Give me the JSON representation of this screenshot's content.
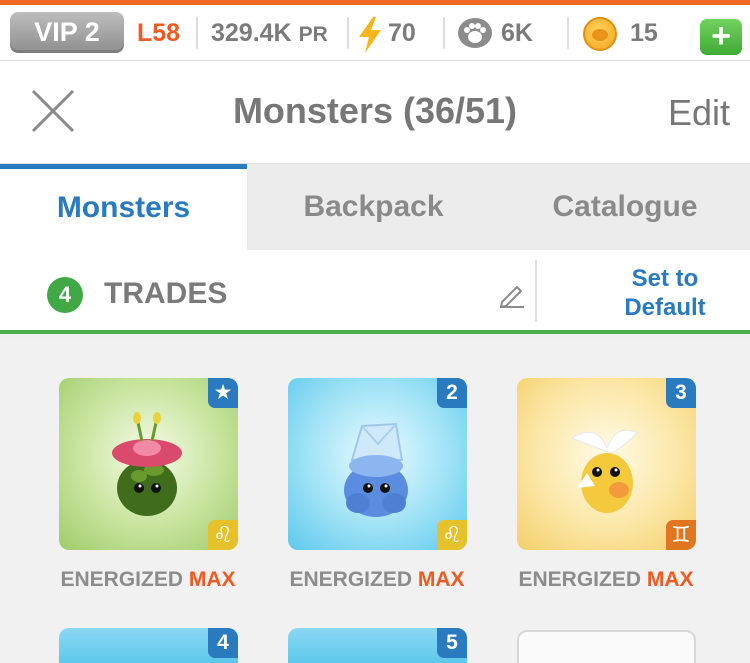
{
  "status_bar": {
    "vip": "VIP 2",
    "level": "L58",
    "power": "329.4K",
    "power_unit": "PR",
    "energy": "70",
    "paws": "6K",
    "coins": "15",
    "add_symbol": "+"
  },
  "header": {
    "title": "Monsters (36/51)",
    "edit_label": "Edit"
  },
  "tabs": [
    {
      "label": "Monsters",
      "active": true
    },
    {
      "label": "Backpack",
      "active": false
    },
    {
      "label": "Catalogue",
      "active": false
    }
  ],
  "trades": {
    "count": "4",
    "label": "TRADES",
    "set_default_line1": "Set to",
    "set_default_line2": "Default"
  },
  "cards": [
    {
      "slot": "★",
      "sign_icon": "leo-icon",
      "sign_glyph": "♌",
      "theme": "green",
      "label_energized": "ENERGIZED",
      "label_max": "MAX"
    },
    {
      "slot": "2",
      "sign_icon": "leo-icon",
      "sign_glyph": "♌",
      "theme": "blue",
      "label_energized": "ENERGIZED",
      "label_max": "MAX"
    },
    {
      "slot": "3",
      "sign_icon": "gemini-icon",
      "sign_glyph": "♊",
      "theme": "yellow",
      "label_energized": "ENERGIZED",
      "label_max": "MAX"
    },
    {
      "slot": "4",
      "theme": "blue"
    },
    {
      "slot": "5",
      "theme": "blue"
    }
  ],
  "colors": {
    "accent_orange": "#ee5a20",
    "tab_blue": "#2a7ac0",
    "trades_green": "#40a844"
  }
}
